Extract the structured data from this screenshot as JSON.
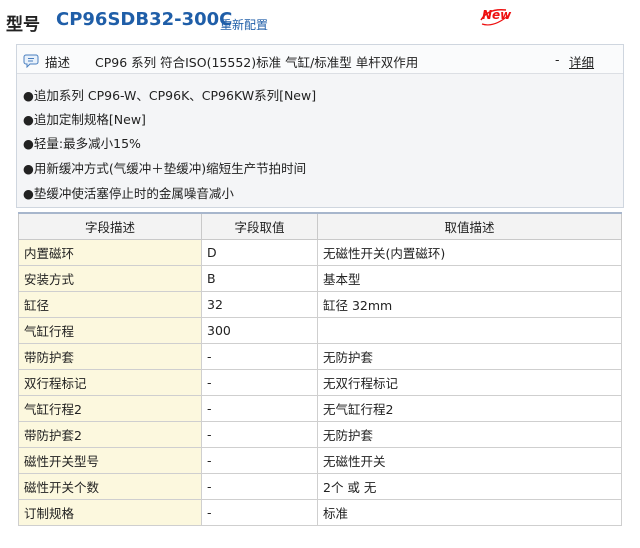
{
  "header": {
    "title_label": "型号",
    "model": "CP96SDB32-300C",
    "reset_label": "重新配置",
    "new_badge": "New"
  },
  "description": {
    "label": "描述",
    "text": "CP96 系列 符合ISO(15552)标准 气缸/标准型 单杆双作用",
    "detail_dash": "-",
    "detail_link": "详细",
    "features": [
      "●追加系列 CP96-W、CP96K、CP96KW系列[New]",
      "●追加定制规格[New]",
      "●轻量:最多减小15%",
      "●用新缓冲方式(气缓冲＋垫缓冲)缩短生产节拍时间",
      "●垫缓冲使活塞停止时的金属噪音减小"
    ]
  },
  "table": {
    "headers": [
      "字段描述",
      "字段取值",
      "取值描述"
    ],
    "rows": [
      {
        "name": "内置磁环",
        "value": "D",
        "desc": "无磁性开关(内置磁环)"
      },
      {
        "name": "安装方式",
        "value": "B",
        "desc": "基本型"
      },
      {
        "name": "缸径",
        "value": "32",
        "desc": "缸径 32mm"
      },
      {
        "name": "气缸行程",
        "value": "300",
        "desc": ""
      },
      {
        "name": "带防护套",
        "value": "-",
        "desc": "无防护套"
      },
      {
        "name": "双行程标记",
        "value": "-",
        "desc": "无双行程标记"
      },
      {
        "name": "气缸行程2",
        "value": "-",
        "desc": "无气缸行程2"
      },
      {
        "name": "带防护套2",
        "value": "-",
        "desc": "无防护套"
      },
      {
        "name": "磁性开关型号",
        "value": "-",
        "desc": "无磁性开关"
      },
      {
        "name": "磁性开关个数",
        "value": "-",
        "desc": "2个 或 无"
      },
      {
        "name": "订制规格",
        "value": "-",
        "desc": "标准"
      }
    ]
  },
  "colors": {
    "model_blue": "#1f5ea8",
    "new_red": "#e11111",
    "name_cell_bg": "#fcf8de"
  }
}
